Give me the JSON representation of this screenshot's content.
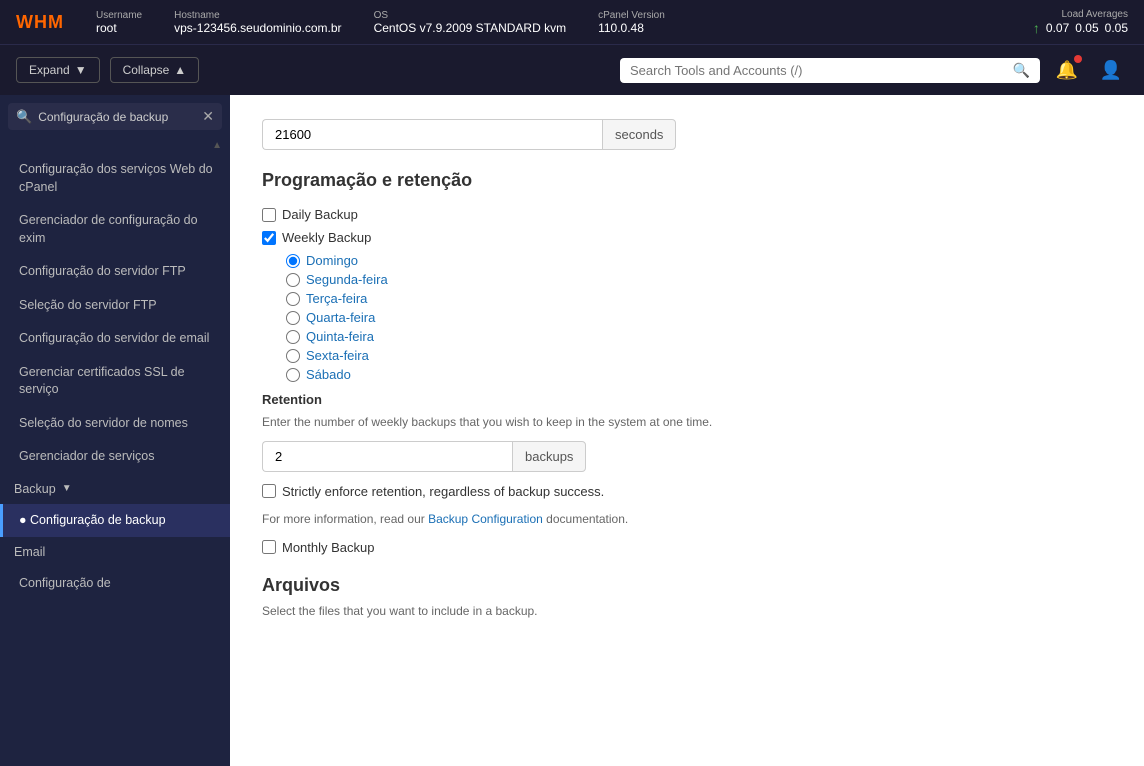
{
  "topbar": {
    "logo": "WHM",
    "username_label": "Username",
    "username_value": "root",
    "hostname_label": "Hostname",
    "hostname_value": "vps-123456.seudominio.com.br",
    "os_label": "OS",
    "os_value": "CentOS v7.9.2009 STANDARD kvm",
    "cpanel_label": "cPanel Version",
    "cpanel_value": "110.0.48",
    "load_label": "Load Averages",
    "load_1": "0.07",
    "load_5": "0.05",
    "load_15": "0.05"
  },
  "actionbar": {
    "expand_label": "Expand",
    "collapse_label": "Collapse",
    "search_placeholder": "Search Tools and Accounts (/)"
  },
  "sidebar": {
    "search_placeholder": "Configuração de backup",
    "items": [
      {
        "label": "Configuração dos serviços Web do cPanel",
        "active": false
      },
      {
        "label": "Gerenciador de configuração do exim",
        "active": false
      },
      {
        "label": "Configuração do servidor FTP",
        "active": false
      },
      {
        "label": "Seleção do servidor FTP",
        "active": false
      },
      {
        "label": "Configuração do servidor de email",
        "active": false
      },
      {
        "label": "Gerenciar certificados SSL de serviço",
        "active": false
      },
      {
        "label": "Seleção do servidor de nomes",
        "active": false
      },
      {
        "label": "Gerenciador de serviços",
        "active": false
      }
    ],
    "section_backup": "Backup",
    "active_item": "Configuração de backup",
    "section_email": "Email",
    "last_item": "Configuração de"
  },
  "content": {
    "seconds_value": "21600",
    "seconds_suffix": "seconds",
    "section_title": "Programação e retenção",
    "daily_label": "Daily Backup",
    "daily_checked": false,
    "weekly_label": "Weekly Backup",
    "weekly_checked": true,
    "days": [
      {
        "label": "Domingo",
        "checked": true
      },
      {
        "label": "Segunda-feira",
        "checked": false
      },
      {
        "label": "Terça-feira",
        "checked": false
      },
      {
        "label": "Quarta-feira",
        "checked": false
      },
      {
        "label": "Quinta-feira",
        "checked": false
      },
      {
        "label": "Sexta-feira",
        "checked": false
      },
      {
        "label": "Sábado",
        "checked": false
      }
    ],
    "retention_label": "Retention",
    "retention_desc": "Enter the number of weekly backups that you wish to keep in the system at one time.",
    "retention_value": "2",
    "retention_suffix": "backups",
    "strictly_label": "Strictly enforce retention, regardless of backup success.",
    "strictly_checked": false,
    "info_text_before": "For more information, read our ",
    "info_link_label": "Backup Configuration",
    "info_text_after": " documentation.",
    "monthly_label": "Monthly Backup",
    "monthly_checked": false,
    "arquivos_title": "Arquivos",
    "arquivos_desc": "Select the files that you want to include in a backup."
  }
}
